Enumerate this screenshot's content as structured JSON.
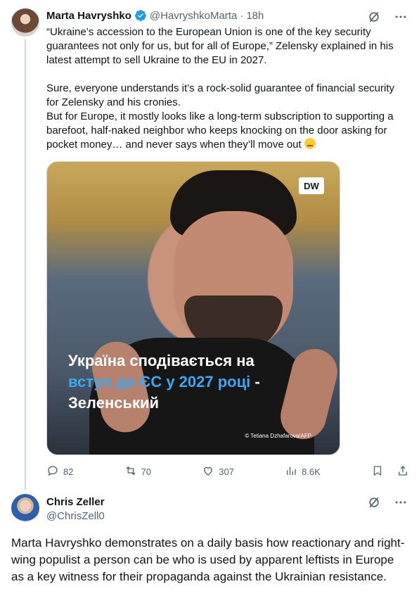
{
  "tweet1": {
    "display_name": "Marta Havryshko",
    "handle": "@HavryshkoMarta",
    "separator": "·",
    "time": "18h",
    "text": "“Ukraine’s accession to the European Union is one of the key security guarantees not only for us, but for all of Europe,” Zelensky explained in his latest attempt to sell Ukraine to the EU in 2027.\n\nSure, everyone understands it’s a rock-solid guarantee of financial security for Zelensky and his cronies.\nBut for Europe, it mostly looks like a long-term subscription to supporting a barefoot, half-naked neighbor who keeps knocking on the door asking for pocket money… and never says when they’ll move out ",
    "media": {
      "logo": "DW",
      "overlay_line1": "Україна сподівається на",
      "overlay_line2_blue": "вступ до ЄС у 2027 році",
      "overlay_line2_rest": " -",
      "overlay_line3": "Зеленський",
      "credit": "© Tetiana Dzhafarova/AFP"
    },
    "replies": "82",
    "reposts": "70",
    "likes": "307",
    "views": "8.6K"
  },
  "tweet2": {
    "display_name": "Chris Zeller",
    "handle": "@ChrisZell0",
    "text": "Marta Havryshko demonstrates on a daily basis how reactionary and right-wing populist a person can be who is used by apparent leftists in Europe as a key witness for their propaganda against the Ukrainian resistance."
  },
  "colors": {
    "text": "#0f1419",
    "muted": "#536471",
    "verified": "#1d9bf0",
    "overlay_blue": "#3ea7f2"
  },
  "icons": [
    "verified-icon",
    "grok-icon",
    "more-icon",
    "reply-icon",
    "repost-icon",
    "like-icon",
    "views-icon",
    "bookmark-icon",
    "share-icon"
  ]
}
